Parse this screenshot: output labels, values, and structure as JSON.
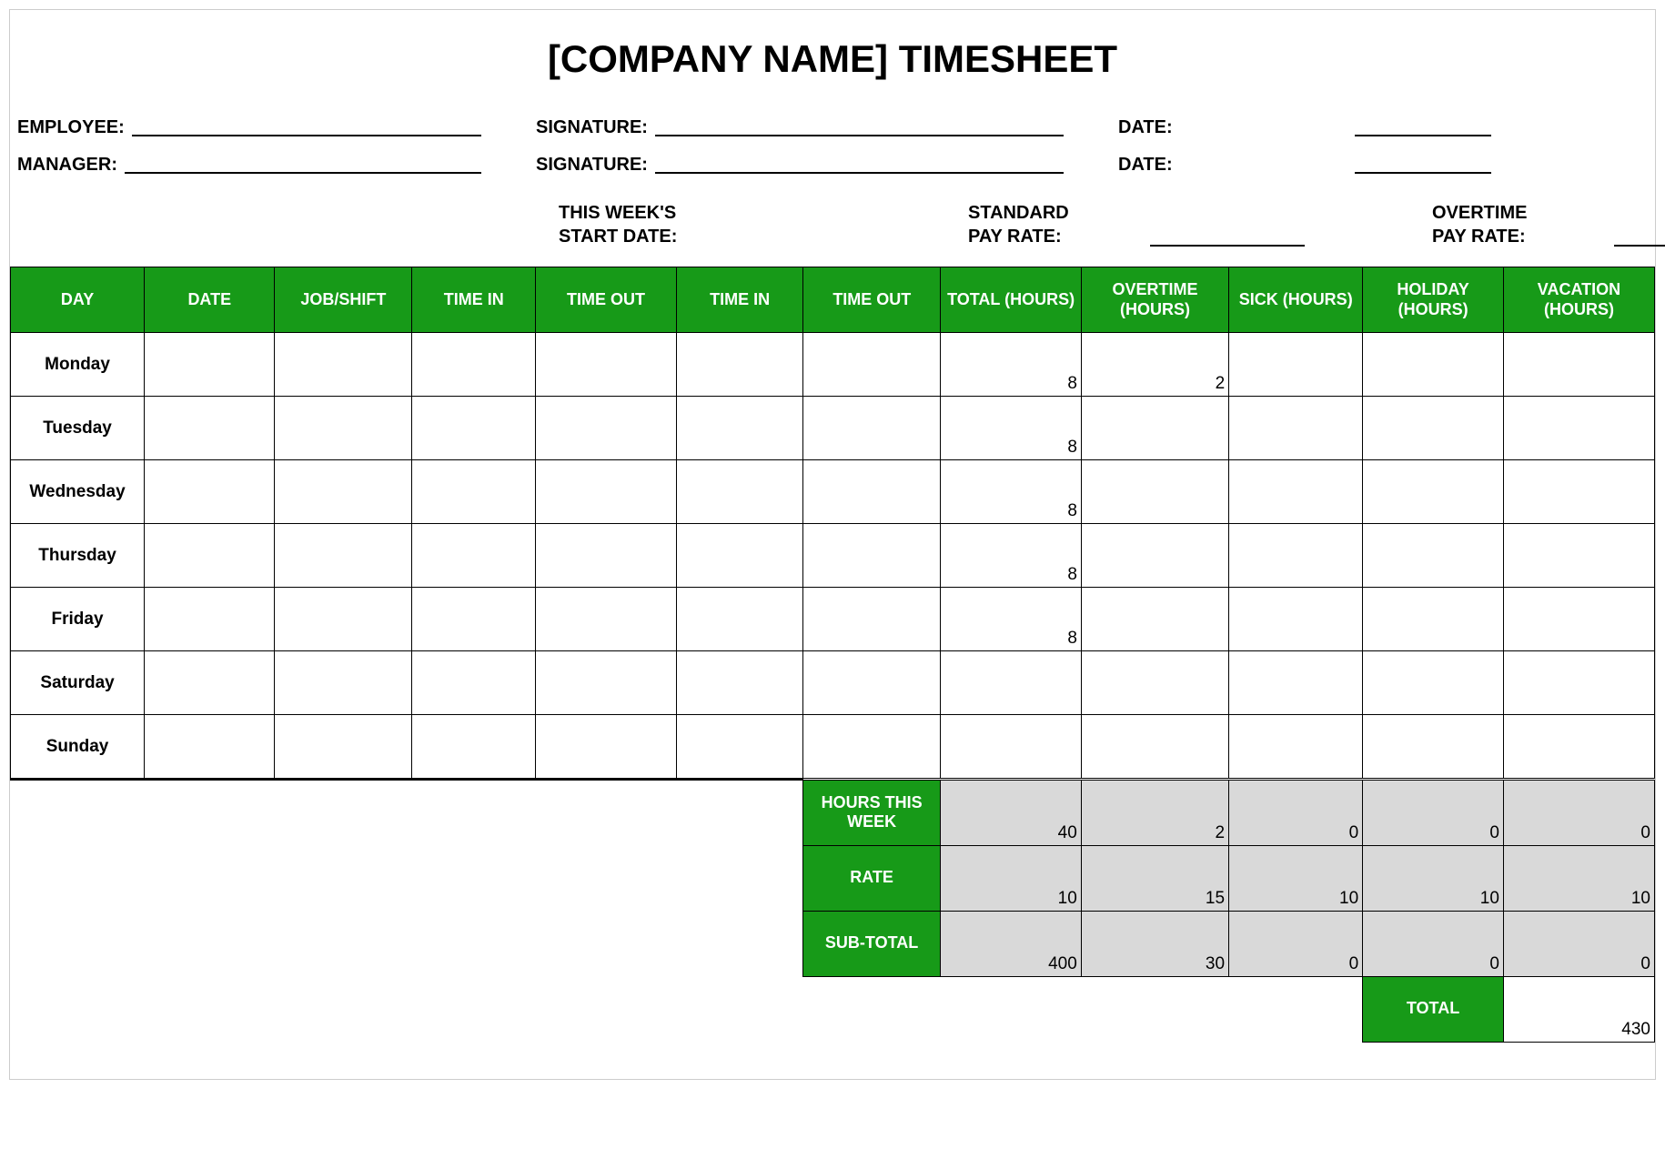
{
  "title": "[COMPANY NAME] TIMESHEET",
  "labels": {
    "employee": "EMPLOYEE:",
    "manager": "MANAGER:",
    "signature": "SIGNATURE:",
    "date": "DATE:",
    "weekStart": "THIS WEEK'S",
    "weekStart2": "START DATE:",
    "stdPay1": "STANDARD",
    "stdPay2": "PAY RATE:",
    "otPay1": "OVERTIME",
    "otPay2": "PAY RATE:"
  },
  "columns": [
    "DAY",
    "DATE",
    "JOB/SHIFT",
    "TIME IN",
    "TIME OUT",
    "TIME IN",
    "TIME OUT",
    "TOTAL (HOURS)",
    "OVERTIME (HOURS)",
    "SICK (HOURS)",
    "HOLIDAY (HOURS)",
    "VACATION (HOURS)"
  ],
  "rows": [
    {
      "day": "Monday",
      "date": "",
      "job": "",
      "ti1": "",
      "to1": "",
      "ti2": "",
      "to2": "",
      "total": "8",
      "overtime": "2",
      "sick": "",
      "holiday": "",
      "vacation": ""
    },
    {
      "day": "Tuesday",
      "date": "",
      "job": "",
      "ti1": "",
      "to1": "",
      "ti2": "",
      "to2": "",
      "total": "8",
      "overtime": "",
      "sick": "",
      "holiday": "",
      "vacation": ""
    },
    {
      "day": "Wednesday",
      "date": "",
      "job": "",
      "ti1": "",
      "to1": "",
      "ti2": "",
      "to2": "",
      "total": "8",
      "overtime": "",
      "sick": "",
      "holiday": "",
      "vacation": ""
    },
    {
      "day": "Thursday",
      "date": "",
      "job": "",
      "ti1": "",
      "to1": "",
      "ti2": "",
      "to2": "",
      "total": "8",
      "overtime": "",
      "sick": "",
      "holiday": "",
      "vacation": ""
    },
    {
      "day": "Friday",
      "date": "",
      "job": "",
      "ti1": "",
      "to1": "",
      "ti2": "",
      "to2": "",
      "total": "8",
      "overtime": "",
      "sick": "",
      "holiday": "",
      "vacation": ""
    },
    {
      "day": "Saturday",
      "date": "",
      "job": "",
      "ti1": "",
      "to1": "",
      "ti2": "",
      "to2": "",
      "total": "",
      "overtime": "",
      "sick": "",
      "holiday": "",
      "vacation": ""
    },
    {
      "day": "Sunday",
      "date": "",
      "job": "",
      "ti1": "",
      "to1": "",
      "ti2": "",
      "to2": "",
      "total": "",
      "overtime": "",
      "sick": "",
      "holiday": "",
      "vacation": ""
    }
  ],
  "summary": {
    "labels": {
      "hours": "HOURS THIS WEEK",
      "rate": "RATE",
      "subtotal": "SUB-TOTAL",
      "total": "TOTAL"
    },
    "hours": {
      "total": "40",
      "overtime": "2",
      "sick": "0",
      "holiday": "0",
      "vacation": "0"
    },
    "rate": {
      "total": "10",
      "overtime": "15",
      "sick": "10",
      "holiday": "10",
      "vacation": "10"
    },
    "subtotal": {
      "total": "400",
      "overtime": "30",
      "sick": "0",
      "holiday": "0",
      "vacation": "0"
    },
    "grand": "430"
  }
}
